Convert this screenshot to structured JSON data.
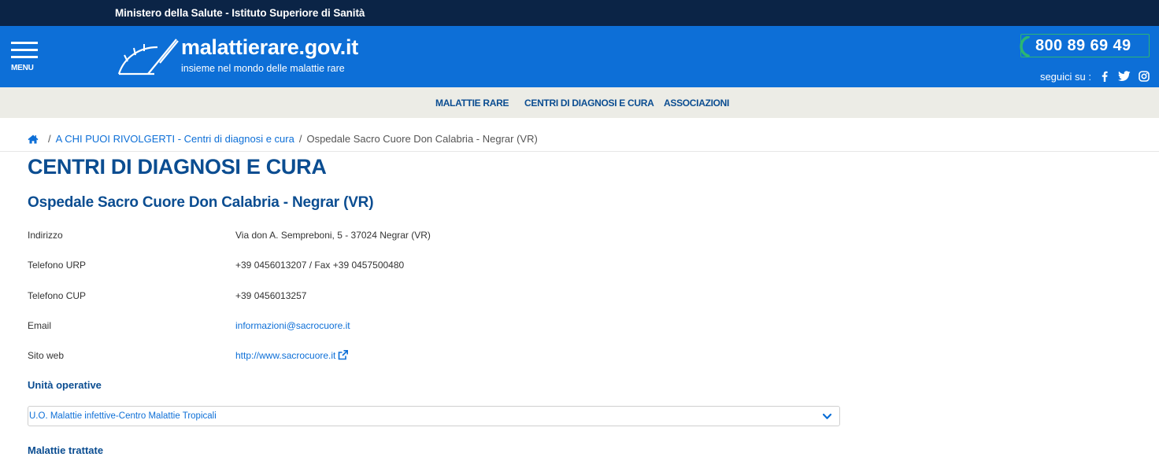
{
  "topbar": {
    "ministry_text": "Ministero della Salute  -  Istituto Superiore di Sanità"
  },
  "header": {
    "menu_label": "MENU",
    "logo_title": "malattierare.gov.it",
    "logo_subtitle": "insieme nel mondo delle malattie rare",
    "phone": "800 89 69 49",
    "follow_label": "seguici su :",
    "social_icons": [
      "facebook-icon",
      "twitter-icon",
      "instagram-icon"
    ],
    "brand_color": "#0d6fd7",
    "topbar_color": "#0b2446",
    "phone_border_color": "#2bb673"
  },
  "nav": {
    "items": [
      {
        "label": "MALATTIE RARE"
      },
      {
        "label": "CENTRI DI DIAGNOSI E CURA"
      },
      {
        "label": "ASSOCIAZIONI"
      }
    ]
  },
  "breadcrumb": {
    "home_icon": "home-icon",
    "items": [
      {
        "label": "A CHI PUOI RIVOLGERTI - Centri di diagnosi e cura"
      },
      {
        "label": "Ospedale Sacro Cuore Don Calabria - Negrar (VR)"
      }
    ]
  },
  "page": {
    "title": "CENTRI DI DIAGNOSI E CURA",
    "center_name": "Ospedale Sacro Cuore Don Calabria - Negrar (VR)"
  },
  "info": {
    "rows": [
      {
        "label": "Indirizzo",
        "value": "Via don A. Sempreboni, 5 - 37024 Negrar (VR)"
      },
      {
        "label": "Telefono URP",
        "value": "+39 0456013207 / Fax +39 0457500480"
      },
      {
        "label": "Telefono CUP",
        "value": "+39 0456013257"
      },
      {
        "label": "Email",
        "value": "informazioni@sacrocuore.it"
      },
      {
        "label": "Sito web",
        "value": "http://www.sacrocuore.it"
      }
    ]
  },
  "units": {
    "heading": "Unità operative",
    "selected": "U.O. Malattie infettive-Centro Malattie Tropicali"
  },
  "diseases": {
    "heading": "Malattie trattate"
  }
}
